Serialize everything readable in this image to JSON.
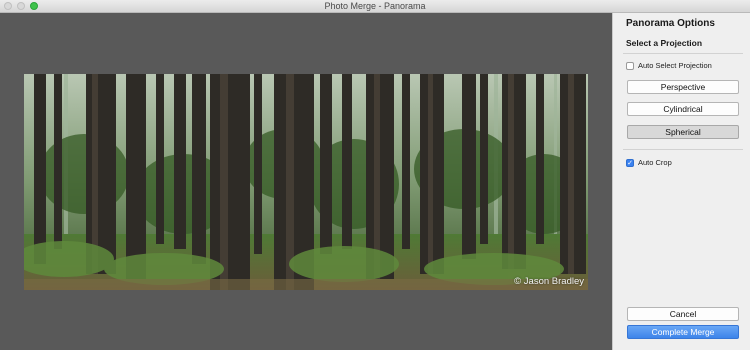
{
  "window": {
    "title": "Photo Merge - Panorama"
  },
  "preview": {
    "copyright": "© Jason Bradley"
  },
  "panel": {
    "title": "Panorama Options",
    "projection_heading": "Select a Projection",
    "auto_select_label": "Auto Select Projection",
    "auto_select_checked": false,
    "projections": [
      "Perspective",
      "Cylindrical",
      "Spherical"
    ],
    "selected_projection": "Spherical",
    "auto_crop_label": "Auto Crop",
    "auto_crop_checked": true,
    "cancel_label": "Cancel",
    "complete_label": "Complete Merge"
  },
  "colors": {
    "accent": "#3d84ea",
    "preview_bg": "#595959",
    "panel_bg": "#efefef"
  }
}
